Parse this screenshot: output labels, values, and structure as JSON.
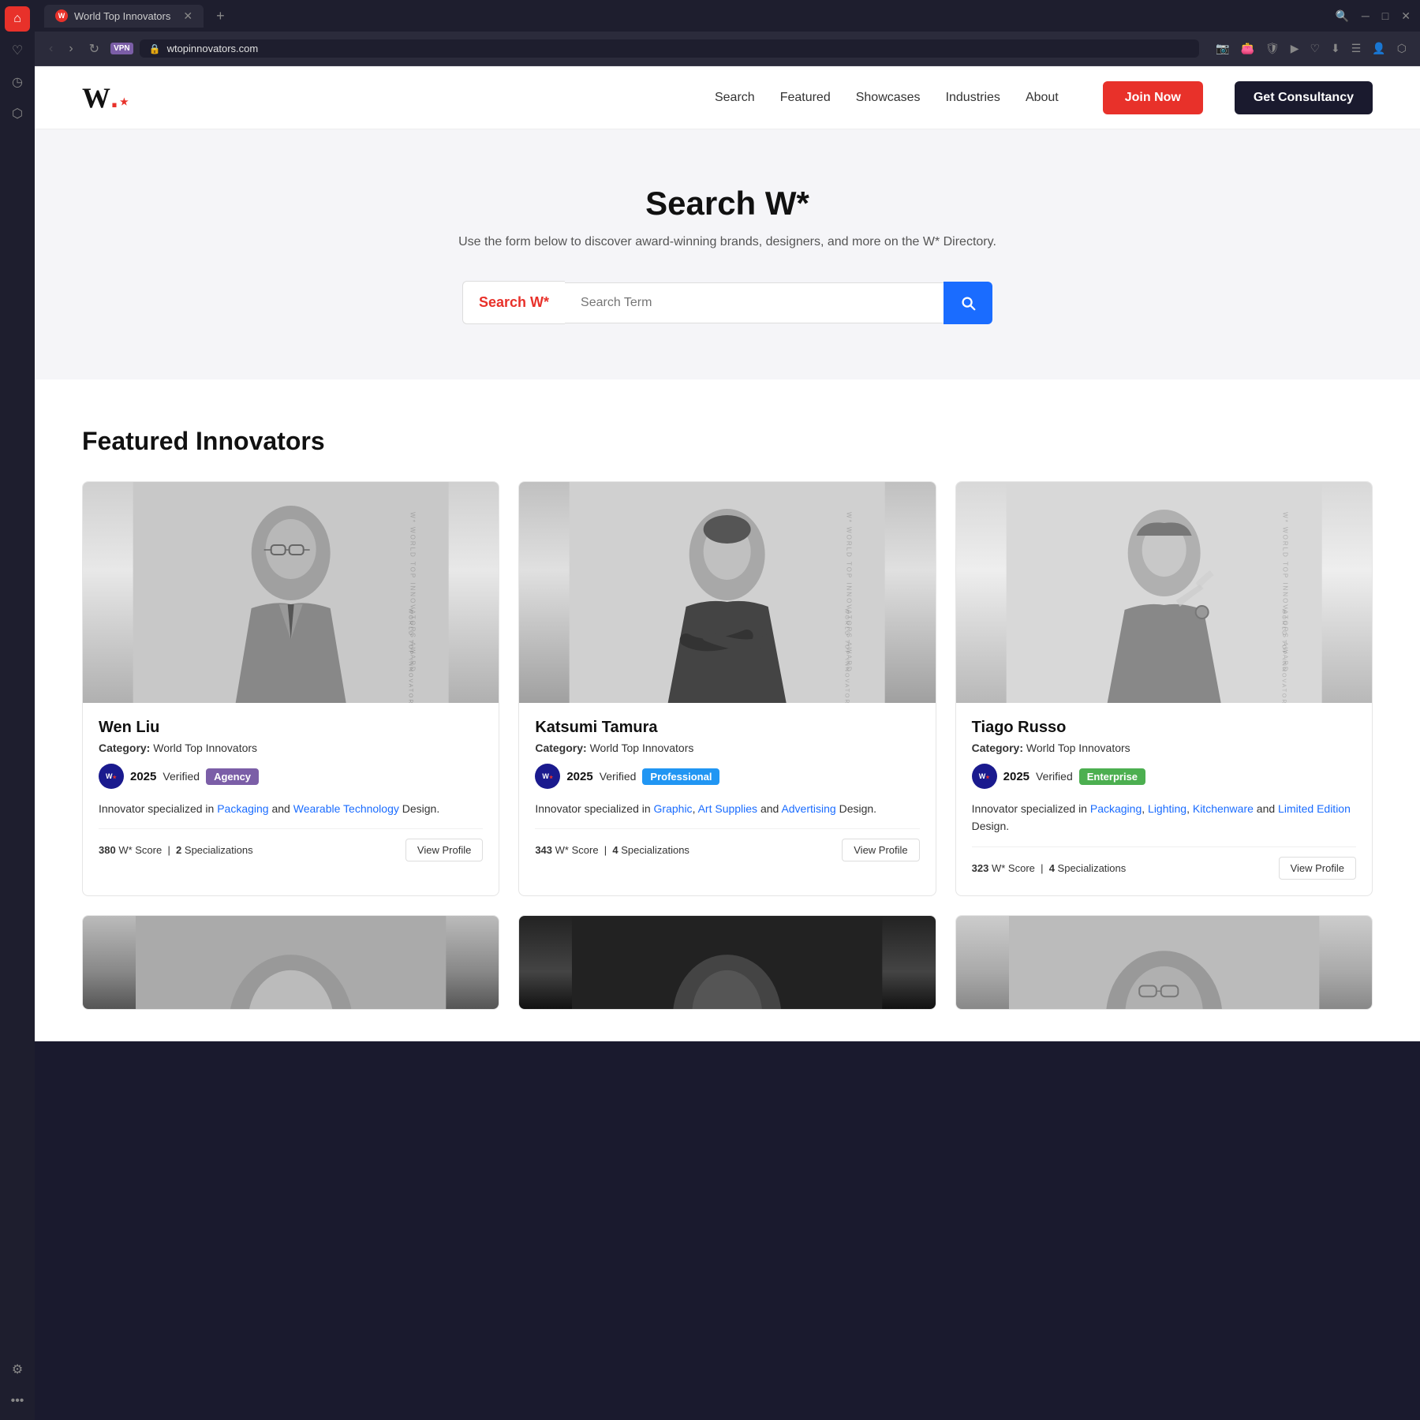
{
  "browser": {
    "tab_title": "World Top Innovators",
    "url": "wtopinnovators.com",
    "new_tab_label": "+",
    "favicon_letter": "W"
  },
  "nav": {
    "logo": "W",
    "logo_star": "★",
    "links": [
      {
        "label": "Search",
        "id": "search"
      },
      {
        "label": "Featured",
        "id": "featured"
      },
      {
        "label": "Showcases",
        "id": "showcases"
      },
      {
        "label": "Industries",
        "id": "industries"
      },
      {
        "label": "About",
        "id": "about"
      }
    ],
    "join_label": "Join Now",
    "consultancy_label": "Get Consultancy"
  },
  "hero": {
    "title": "Search W*",
    "description": "Use the form below to discover award-winning brands, designers, and more on the W* Directory.",
    "search_label": "Search W",
    "search_label_star": "*",
    "search_placeholder": "Search Term",
    "search_button_icon": "search"
  },
  "featured": {
    "section_title": "Featured Innovators",
    "cards": [
      {
        "id": "wen-liu",
        "name": "Wen Liu",
        "category_label": "Category:",
        "category": "World Top Innovators",
        "year": "2025",
        "verified": "Verified",
        "badge_type": "Agency",
        "badge_class": "badge-agency",
        "description_start": "Innovator specialized in ",
        "specializations": [
          "Packaging",
          "Wearable Technology"
        ],
        "description_end": " Design.",
        "conjunction": "and",
        "score": "380",
        "score_suffix": "W* Score",
        "spec_count": "2",
        "spec_label": "Specializations",
        "view_label": "View Profile",
        "portrait_class": "portrait-1"
      },
      {
        "id": "katsumi-tamura",
        "name": "Katsumi Tamura",
        "category_label": "Category:",
        "category": "World Top Innovators",
        "year": "2025",
        "verified": "Verified",
        "badge_type": "Professional",
        "badge_class": "badge-professional",
        "description_start": "Innovator specialized in ",
        "specializations": [
          "Graphic",
          "Art Supplies",
          "Advertising"
        ],
        "description_end": " Design.",
        "conjunction": "and",
        "score": "343",
        "score_suffix": "W* Score",
        "spec_count": "4",
        "spec_label": "Specializations",
        "view_label": "View Profile",
        "portrait_class": "portrait-2"
      },
      {
        "id": "tiago-russo",
        "name": "Tiago Russo",
        "category_label": "Category:",
        "category": "World Top Innovators",
        "year": "2025",
        "verified": "Verified",
        "badge_type": "Enterprise",
        "badge_class": "badge-enterprise",
        "description_start": "Innovator specialized in ",
        "specializations": [
          "Packaging",
          "Lighting",
          "Kitchenware",
          "Limited Edition"
        ],
        "description_end": " Design.",
        "conjunction": "and",
        "score": "323",
        "score_suffix": "W* Score",
        "spec_count": "4",
        "spec_label": "Specializations",
        "view_label": "View Profile",
        "portrait_class": "portrait-3"
      }
    ]
  },
  "sidebar": {
    "icons": [
      {
        "name": "home-icon",
        "symbol": "⌂",
        "active": true
      },
      {
        "name": "bookmark-icon",
        "symbol": "♡",
        "active": false
      },
      {
        "name": "history-icon",
        "symbol": "◷",
        "active": false
      },
      {
        "name": "extensions-icon",
        "symbol": "⬡",
        "active": false
      },
      {
        "name": "settings-icon",
        "symbol": "⚙",
        "active": false
      },
      {
        "name": "more-icon",
        "symbol": "…",
        "active": false
      }
    ]
  }
}
